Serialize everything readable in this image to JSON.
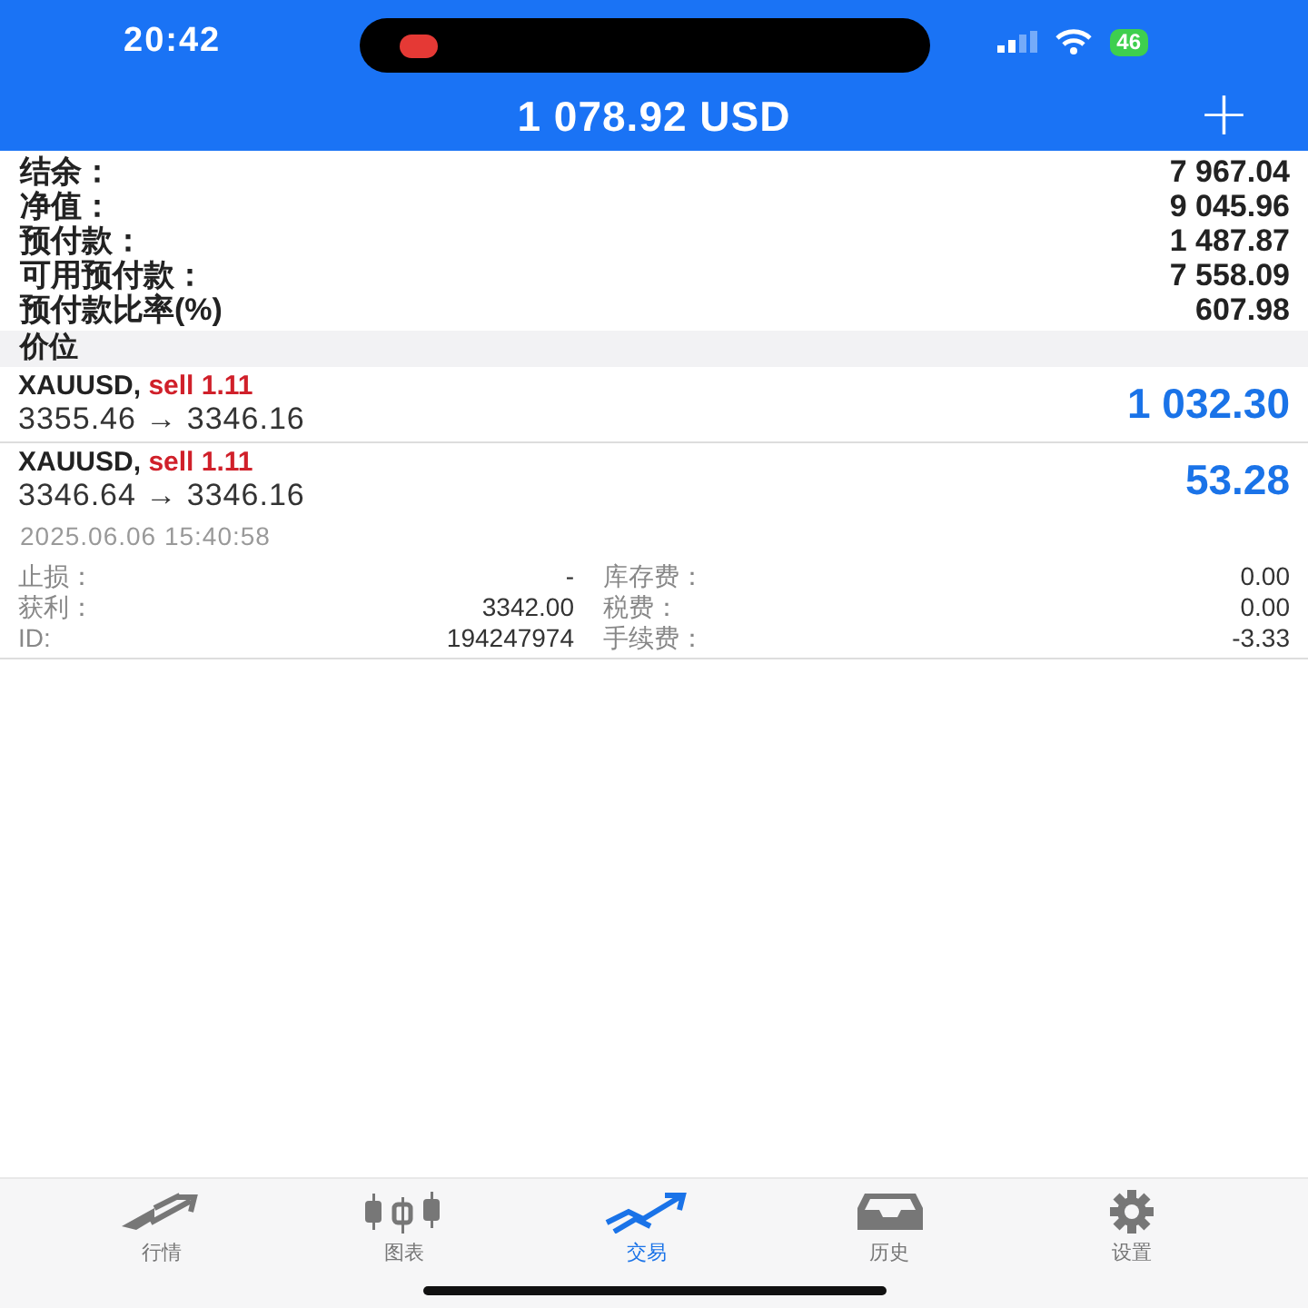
{
  "status_bar": {
    "time": "20:42",
    "battery": "46"
  },
  "header": {
    "title": "1 078.92 USD",
    "add_button": "+"
  },
  "summary": [
    {
      "label": "结余：",
      "value": "7 967.04"
    },
    {
      "label": "净值：",
      "value": "9 045.96"
    },
    {
      "label": "预付款：",
      "value": "1 487.87"
    },
    {
      "label": "可用预付款：",
      "value": "7 558.09"
    },
    {
      "label": "预付款比率(%)",
      "value": "607.98"
    }
  ],
  "section_title": "价位",
  "positions": [
    {
      "symbol": "XAUUSD,",
      "side": "sell 1.11",
      "prices": "3355.46 → 3346.16",
      "profit": "1 032.30",
      "expanded": false
    },
    {
      "symbol": "XAUUSD,",
      "side": "sell 1.11",
      "prices": "3346.64 → 3346.16",
      "profit": "53.28",
      "expanded": true,
      "time": "2025.06.06 15:40:58",
      "details": [
        {
          "label": "止损：",
          "value": "-",
          "label2": "库存费：",
          "value2": "0.00"
        },
        {
          "label": "获利：",
          "value": "3342.00",
          "label2": "税费：",
          "value2": "0.00"
        },
        {
          "label": "ID:",
          "value": "194247974",
          "label2": "手续费：",
          "value2": "-3.33"
        }
      ]
    }
  ],
  "tabs": [
    {
      "label": "行情",
      "selected": false
    },
    {
      "label": "图表",
      "selected": false
    },
    {
      "label": "交易",
      "selected": true
    },
    {
      "label": "历史",
      "selected": false
    },
    {
      "label": "设置",
      "selected": false
    }
  ]
}
